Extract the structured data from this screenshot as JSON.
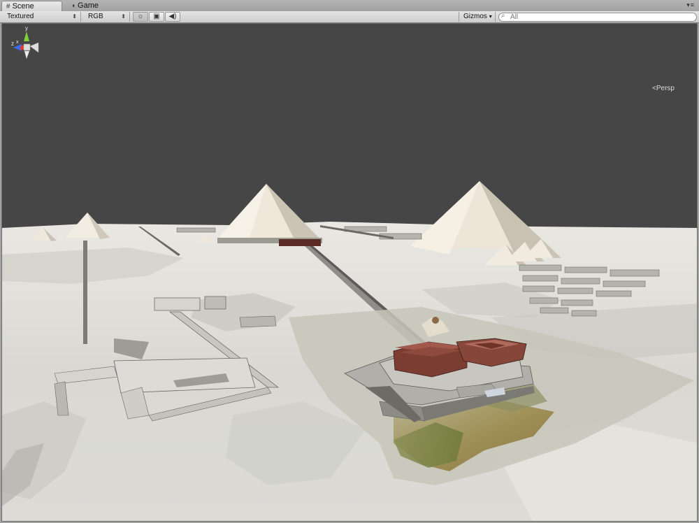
{
  "tabs": [
    {
      "label": "Scene",
      "icon": "grid-icon",
      "active": true
    },
    {
      "label": "Game",
      "icon": "pacman-icon",
      "active": false
    }
  ],
  "toolbar": {
    "draw_mode": "Textured",
    "render_mode": "RGB",
    "lighting_icon": "sun-icon",
    "image_icon": "image-icon",
    "audio_icon": "speaker-icon",
    "gizmos_label": "Gizmos",
    "search_placeholder": "All"
  },
  "scene": {
    "projection_label": "Persp",
    "axes": {
      "y": "y",
      "x": "x",
      "z": "z"
    },
    "colors": {
      "sky": "#464646",
      "terrain": "#e2e1dc",
      "pyramid": "#eee8dc",
      "temple": "#7a3b30"
    }
  }
}
